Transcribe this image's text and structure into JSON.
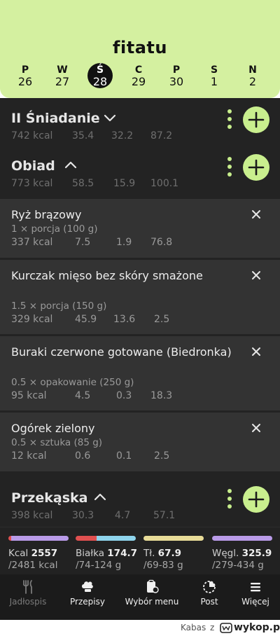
{
  "app": {
    "title": "fitatu"
  },
  "days": [
    {
      "letter": "P",
      "num": "26"
    },
    {
      "letter": "W",
      "num": "27"
    },
    {
      "letter": "Ś",
      "num": "28",
      "active": true
    },
    {
      "letter": "C",
      "num": "29"
    },
    {
      "letter": "P",
      "num": "30"
    },
    {
      "letter": "S",
      "num": "1"
    },
    {
      "letter": "N",
      "num": "2"
    }
  ],
  "meals": {
    "breakfast2": {
      "title": "II Śniadanie",
      "kcal": "742 kcal",
      "p": "35.4",
      "f": "32.2",
      "c": "87.2"
    },
    "lunch": {
      "title": "Obiad",
      "kcal": "773 kcal",
      "p": "58.5",
      "f": "15.9",
      "c": "100.1"
    },
    "snack": {
      "title": "Przekąska",
      "kcal": "398 kcal",
      "p": "30.3",
      "f": "4.7",
      "c": "57.1"
    }
  },
  "foods": [
    {
      "name": "Ryż brązowy",
      "qty": "1 × porcja (100 g)",
      "kcal": "337 kcal",
      "p": "7.5",
      "f": "1.9",
      "c": "76.8"
    },
    {
      "name": "Kurczak mięso bez skóry smażone",
      "qty": "1.5 × porcja (150 g)",
      "kcal": "329 kcal",
      "p": "45.9",
      "f": "13.6",
      "c": "2.5"
    },
    {
      "name": "Buraki czerwone gotowane (Biedronka)",
      "qty": "0.5 × opakowanie (250 g)",
      "kcal": "95 kcal",
      "p": "4.5",
      "f": "0.3",
      "c": "18.3"
    },
    {
      "name": "Ogórek zielony",
      "qty": "0.5 × sztuka (85 g)",
      "kcal": "12 kcal",
      "p": "0.6",
      "f": "0.1",
      "c": "2.5"
    }
  ],
  "summary": {
    "kcal": {
      "label": "Kcal",
      "value": "2557",
      "target": "/2481 kcal",
      "color": "#b99be8",
      "over_color": "#e05050",
      "over_fraction": 0.05
    },
    "protein": {
      "label": "Białka",
      "value": "174.7",
      "target": "/74-124 g",
      "color": "#8ed4ec",
      "over_color": "#e05050",
      "over_fraction": 0.35
    },
    "fat": {
      "label": "Tł.",
      "value": "67.9",
      "target": "/69-83 g",
      "color": "#e8dc98"
    },
    "carbs": {
      "label": "Węgl.",
      "value": "325.9",
      "target": "/279-434 g",
      "color": "#b99be8"
    }
  },
  "nav": [
    {
      "label": "Jadłospis",
      "icon": "cutlery-icon",
      "active": true
    },
    {
      "label": "Przepisy",
      "icon": "chef-hat-icon"
    },
    {
      "label": "Wybór menu",
      "icon": "menu-selection-icon"
    },
    {
      "label": "Post",
      "icon": "fasting-clock-icon"
    },
    {
      "label": "Więcej",
      "icon": "hamburger-icon"
    }
  ],
  "footer": {
    "user": "Kabas",
    "z": "z",
    "site": "wykop.pl"
  },
  "colors": {
    "accent": "#c9ef8e",
    "header_bg": "#d4f0a0",
    "dark_bg": "#232323",
    "card_bg": "#333333"
  }
}
